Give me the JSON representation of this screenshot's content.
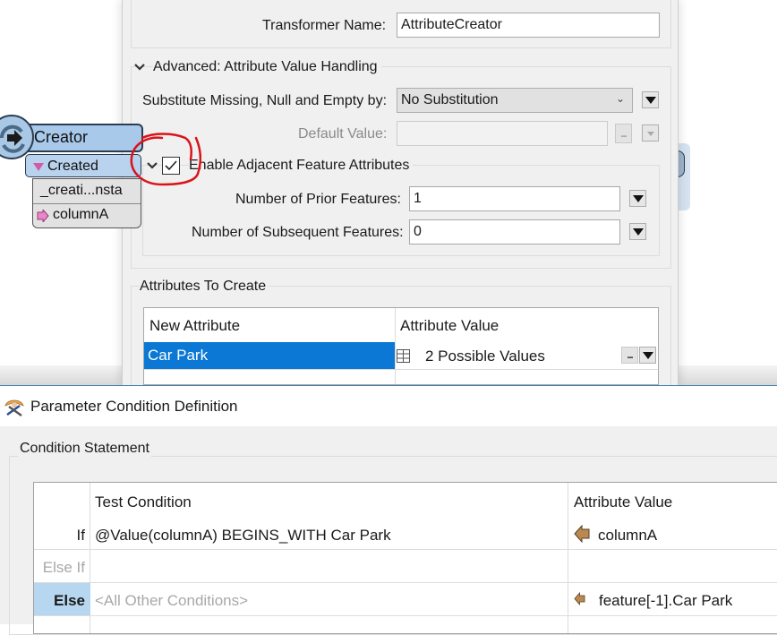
{
  "canvas": {
    "node": {
      "title": "Creator",
      "output_port": "Created",
      "attributes": [
        "_creati...nsta",
        "columnA"
      ],
      "colors": {
        "node_fill": "#a8c9ea",
        "port_fill": "#b9d3ee",
        "border": "#2b3d52",
        "port_marker": "#d25aa6"
      }
    }
  },
  "transformer_dialog": {
    "transformer_name_label": "Transformer Name:",
    "transformer_name_value": "AttributeCreator",
    "advanced_section": {
      "title": "Advanced: Attribute Value Handling",
      "substitute_label": "Substitute Missing, Null and Empty by:",
      "substitute_value": "No Substitution",
      "default_value_label": "Default Value:",
      "default_value": "",
      "dots_label": "..."
    },
    "adjacent_section": {
      "title": "Enable Adjacent Feature Attributes",
      "checked": true,
      "prior_label": "Number of Prior Features:",
      "prior_value": "1",
      "subsequent_label": "Number of Subsequent Features:",
      "subsequent_value": "0"
    },
    "attributes_to_create": {
      "title": "Attributes To Create",
      "columns": [
        "New Attribute",
        "Attribute Value"
      ],
      "rows": [
        {
          "new_attribute": "Car Park",
          "attribute_value": "2 Possible Values",
          "selected": true
        }
      ],
      "dots_label": "..."
    },
    "annotation": "red hand-drawn circle around Enable Adjacent Feature Attributes checkbox",
    "colors": {
      "selection": "#0a78d4",
      "annotation": "#d9141b"
    }
  },
  "condition_window": {
    "title": "Parameter Condition Definition",
    "group_title": "Condition Statement",
    "columns": [
      "Test Condition",
      "Attribute Value"
    ],
    "rows": [
      {
        "label": "If",
        "condition": "@Value(columnA) BEGINS_WITH Car Park",
        "value": "columnA"
      },
      {
        "label": "Else If",
        "condition": "",
        "value": ""
      },
      {
        "label": "Else",
        "condition": "<All Other Conditions>",
        "value": "feature[-1].Car Park",
        "selected": true
      }
    ],
    "colors": {
      "else_highlight": "#b7d7f0",
      "attribute_arrow": "#b88a52"
    }
  }
}
